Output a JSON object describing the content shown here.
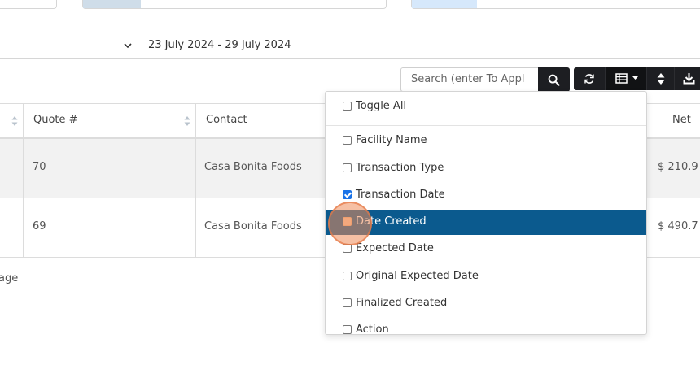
{
  "filters": {
    "date_range": "23 July 2024 - 29 July 2024"
  },
  "toolbar": {
    "search_placeholder": "Search (enter To Appl",
    "icons": [
      "search-icon",
      "refresh-icon",
      "columns-icon",
      "sort-icon",
      "download-icon"
    ]
  },
  "table": {
    "headers": {
      "quote": "Quote #",
      "contact": "Contact",
      "net": "Net"
    },
    "rows": [
      {
        "quote": "70",
        "contact": "Casa Bonita Foods",
        "net": "$ 210.9"
      },
      {
        "quote": "69",
        "contact": "Casa Bonita Foods",
        "net": "$ 490.7"
      }
    ],
    "footer_text": "age"
  },
  "columns_dropdown": {
    "toggle_all": "Toggle All",
    "items": [
      {
        "label": "Facility Name",
        "checked": false
      },
      {
        "label": "Transaction Type",
        "checked": false
      },
      {
        "label": "Transaction Date",
        "checked": true
      },
      {
        "label": "Date Created",
        "checked": false,
        "active": true
      },
      {
        "label": "Expected Date",
        "checked": false
      },
      {
        "label": "Original Expected Date",
        "checked": false
      },
      {
        "label": "Finalized Created",
        "checked": false
      },
      {
        "label": "Action",
        "checked": false
      }
    ]
  },
  "colors": {
    "active_row": "#0b5a8e",
    "dark_button": "#1d1e22",
    "card_accent_1": "#cfdde9",
    "card_accent_2": "#d6e8fb"
  }
}
